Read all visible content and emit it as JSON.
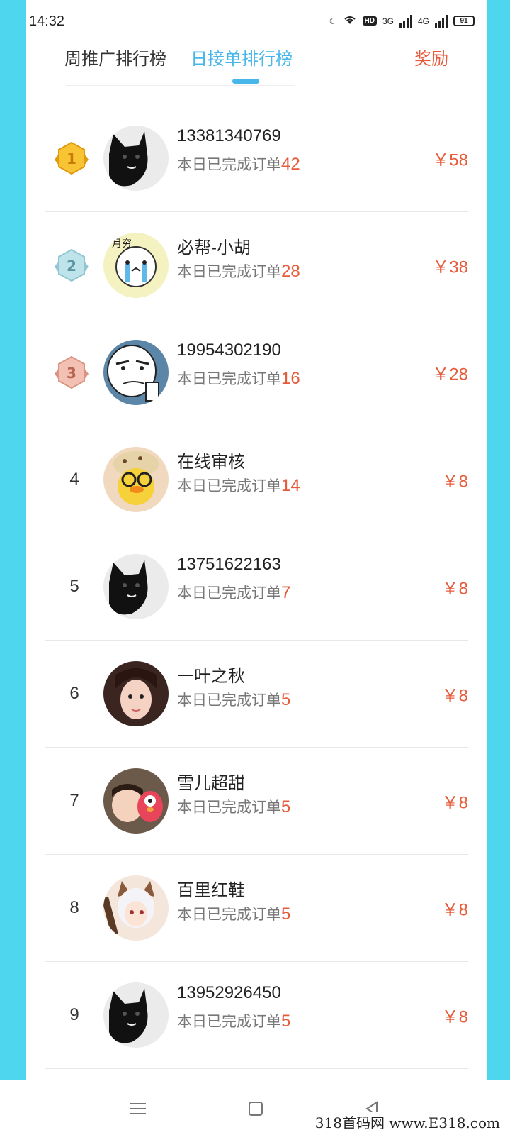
{
  "status_bar": {
    "time": "14:32",
    "hd_label": "HD",
    "net1_label": "3G",
    "net2_label": "4G",
    "battery": "91"
  },
  "tabs": {
    "week": "周推广排行榜",
    "daily": "日接单排行榜",
    "reward": "奖励",
    "active": "daily"
  },
  "rankings": [
    {
      "rank": "1",
      "name": "13381340769",
      "orders_label": "本日已完成订单",
      "orders": "42",
      "reward": "￥58",
      "avatar": "black-cat"
    },
    {
      "rank": "2",
      "name": "必帮-小胡",
      "orders_label": "本日已完成订单",
      "orders": "28",
      "reward": "￥38",
      "avatar": "cartoon-crying"
    },
    {
      "rank": "3",
      "name": "19954302190",
      "orders_label": "本日已完成订单",
      "orders": "16",
      "reward": "￥28",
      "avatar": "meme-face"
    },
    {
      "rank": "4",
      "name": "在线审核",
      "orders_label": "本日已完成订单",
      "orders": "14",
      "reward": "￥8",
      "avatar": "yellow-duck"
    },
    {
      "rank": "5",
      "name": "13751622163",
      "orders_label": "本日已完成订单",
      "orders": "7",
      "reward": "￥8",
      "avatar": "black-cat"
    },
    {
      "rank": "6",
      "name": "一叶之秋",
      "orders_label": "本日已完成订单",
      "orders": "5",
      "reward": "￥8",
      "avatar": "girl-photo"
    },
    {
      "rank": "7",
      "name": "雪儿超甜",
      "orders_label": "本日已完成订单",
      "orders": "5",
      "reward": "￥8",
      "avatar": "child-penguin"
    },
    {
      "rank": "8",
      "name": "百里红鞋",
      "orders_label": "本日已完成订单",
      "orders": "5",
      "reward": "￥8",
      "avatar": "anime-character"
    },
    {
      "rank": "9",
      "name": "13952926450",
      "orders_label": "本日已完成订单",
      "orders": "5",
      "reward": "￥8",
      "avatar": "black-cat"
    }
  ],
  "watermark": "318首码网 www.E318.com",
  "colors": {
    "accent_blue": "#47b7ea",
    "reward_red": "#e65b3a",
    "frame_cyan": "#4fd6ef"
  }
}
